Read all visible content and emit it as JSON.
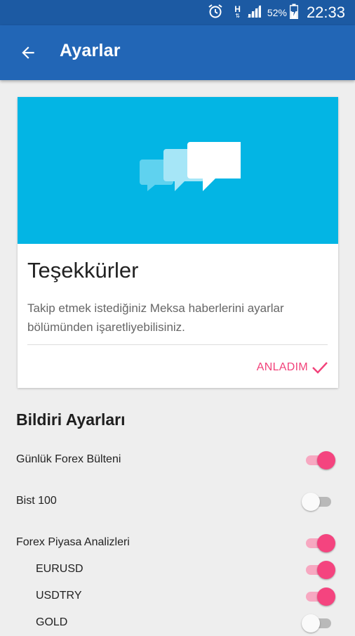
{
  "status_bar": {
    "battery_percent": "52%",
    "time": "22:33",
    "network_label": "H"
  },
  "app_bar": {
    "title": "Ayarlar",
    "back_icon": "arrow-back-icon"
  },
  "info_card": {
    "hero_icon": "chat-bubbles-icon",
    "hero_color": "#03b5e4",
    "title": "Teşekkürler",
    "body": "Takip etmek istediğiniz Meksa haberlerini ayarlar bölümünden işaretliyebilisiniz.",
    "button_label": "ANLADIM",
    "button_icon": "check-icon"
  },
  "notifications": {
    "section_title": "Bildiri Ayarları",
    "accent_color": "#f4447f",
    "items": [
      {
        "label": "Günlük Forex Bülteni",
        "enabled": true
      },
      {
        "label": "Bist 100",
        "enabled": false
      },
      {
        "label": "Forex Piyasa Analizleri",
        "enabled": true
      },
      {
        "label": "EURUSD",
        "enabled": true
      },
      {
        "label": "USDTRY",
        "enabled": true
      },
      {
        "label": "GOLD",
        "enabled": false
      }
    ]
  }
}
